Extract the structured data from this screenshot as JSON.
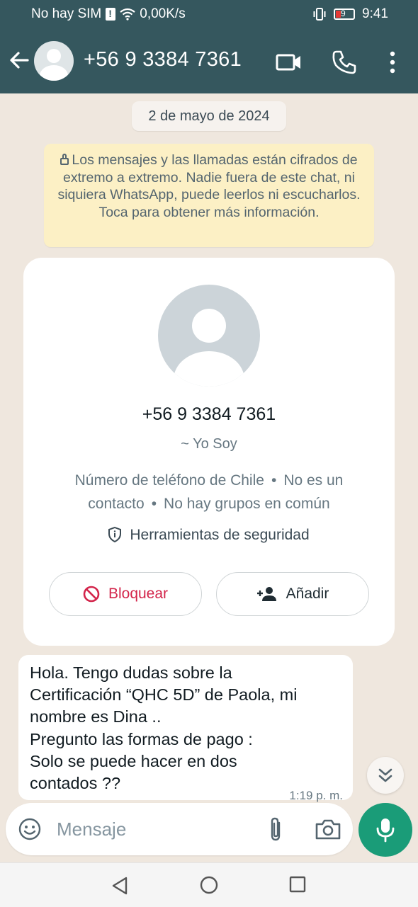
{
  "status_bar": {
    "carrier": "No hay SIM",
    "network_speed": "0,00K/s",
    "battery_level": "9",
    "time": "9:41"
  },
  "header": {
    "contact": "+56 9 3384 7361"
  },
  "chat": {
    "date": "2 de mayo de 2024",
    "encryption_notice": "Los mensajes y las llamadas están cifrados de extremo a extremo. Nadie fuera de este chat, ni siquiera WhatsApp, puede leerlos ni escucharlos. Toca para obtener más información.",
    "contact_card": {
      "phone": "+56 9 3384 7361",
      "push_name": "~ Yo Soy",
      "country_info": "Número de teléfono de Chile",
      "not_contact": "No es un contacto",
      "groups": "No hay grupos en común",
      "separator": "•",
      "security_tools": "Herramientas de seguridad",
      "block_label": "Bloquear",
      "add_label": "Añadir"
    },
    "messages": [
      {
        "text": "Hola. Tengo dudas sobre la\nCertificación “QHC 5D” de Paola, mi\nnombre es Dina ..\nPregunto las formas de pago :\nSolo se puede hacer en dos\ncontados ??",
        "time": "1:19 p. m."
      }
    ]
  },
  "composer": {
    "placeholder": "Mensaje"
  },
  "colors": {
    "header_bg": "#35575e",
    "chat_bg": "#efe7de",
    "notice_bg": "#fcf0c5",
    "block_red": "#d3254b",
    "mic_green": "#1a9c78"
  },
  "icons": [
    "back-arrow-icon",
    "video-call-icon",
    "phone-icon",
    "more-icon",
    "lock-icon",
    "shield-icon",
    "block-icon",
    "add-contact-icon",
    "scroll-down-icon",
    "emoji-icon",
    "attach-icon",
    "camera-icon",
    "mic-icon"
  ]
}
